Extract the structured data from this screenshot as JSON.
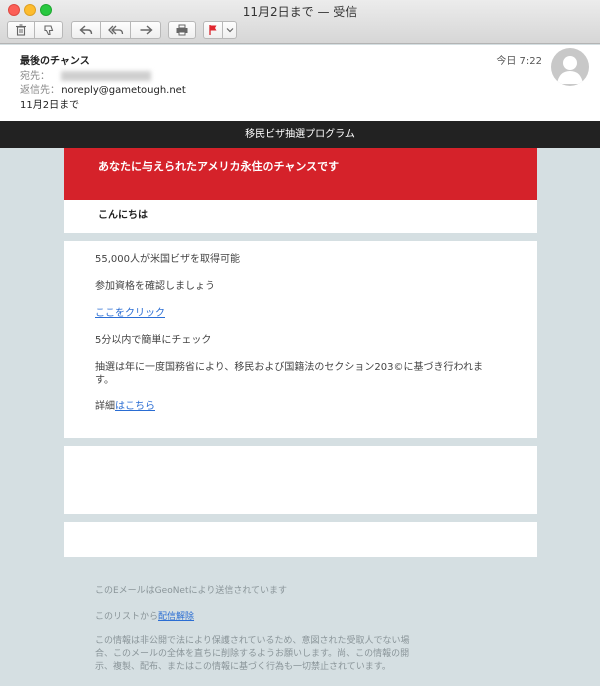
{
  "window": {
    "title": "11月2日まで — 受信"
  },
  "toolbar": {
    "buttons": [
      "trash",
      "junk",
      "reply",
      "reply-all",
      "forward",
      "print",
      "flag"
    ]
  },
  "header": {
    "subject": "最後のチャンス",
    "to_label": "宛先：",
    "reply_label": "返信先：",
    "reply_to": "noreply@gametough.net",
    "deadline": "11月2日まで",
    "time": "今日 7:22"
  },
  "email": {
    "banner": "移民ビザ抽選プログラム",
    "headline": "あなたに与えられたアメリカ永住のチャンスです",
    "greeting": "こんにちは",
    "line1": "55,000人が米国ビザを取得可能",
    "line2": "参加資格を確認しましょう",
    "click_link": "ここをクリック",
    "line3": "5分以内で簡単にチェック",
    "line4a": "抽選は年に一度国務省により、移民および国籍法のセクション203©に基づき行われま",
    "line4b": "す。",
    "details_prefix": "詳細",
    "details_link": "はこちら"
  },
  "footer": {
    "sent_by": "このEメールはGeoNetにより送信されています",
    "unsub_prefix": "このリストから",
    "unsub_link": "配信解除",
    "legal1": "この情報は非公開で法により保護されているため、意図された受取人でない場",
    "legal2": "合、このメールの全体を直ちに削除するようお願いします。尚、この情報の開",
    "legal3": "示、複製、配布、またはこの情報に基づく行為も一切禁止されています。"
  },
  "colors": {
    "accent_red": "#d5222a",
    "banner_bg": "#222222",
    "link": "#2a6dd3",
    "page_bg": "#d5dfe2"
  }
}
